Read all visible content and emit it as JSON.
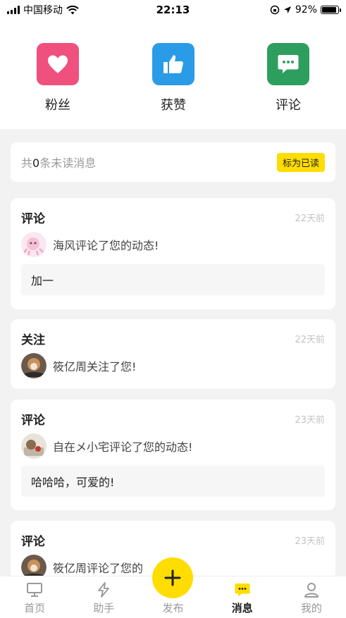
{
  "status_bar": {
    "carrier": "中国移动",
    "time": "22:13",
    "battery": "92%",
    "battery_level": 0.92
  },
  "categories": [
    {
      "label": "粉丝",
      "icon": "heart-icon",
      "color": "#f0507e"
    },
    {
      "label": "获赞",
      "icon": "thumbs-up-icon",
      "color": "#2a9be6"
    },
    {
      "label": "评论",
      "icon": "comment-icon",
      "color": "#2e9e5f"
    }
  ],
  "unread": {
    "prefix": "共",
    "count": "0",
    "suffix": "条未读消息",
    "mark_read_label": "标为已读"
  },
  "notifications": [
    {
      "type": "评论",
      "time": "22天前",
      "message": "海风评论了您的动态!",
      "quote": "加一"
    },
    {
      "type": "关注",
      "time": "22天前",
      "message": "筱亿周关注了您!",
      "quote": ""
    },
    {
      "type": "评论",
      "time": "23天前",
      "message": "自在メ小宅评论了您的动态!",
      "quote": "哈哈哈，可爱的!"
    },
    {
      "type": "评论",
      "time": "23天前",
      "message": "筱亿周评论了您的",
      "quote": ""
    }
  ],
  "tabs": [
    {
      "label": "首页",
      "icon": "monitor-icon"
    },
    {
      "label": "助手",
      "icon": "lightning-icon"
    },
    {
      "label": "发布",
      "icon": "plus-icon"
    },
    {
      "label": "消息",
      "icon": "message-icon"
    },
    {
      "label": "我的",
      "icon": "user-icon"
    }
  ],
  "colors": {
    "accent": "#ffdd00"
  }
}
